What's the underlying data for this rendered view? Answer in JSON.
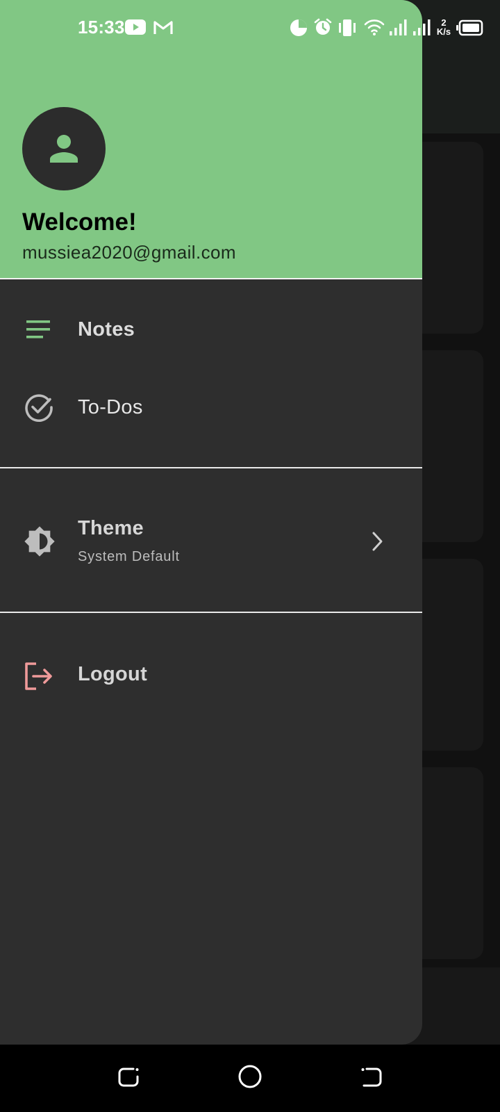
{
  "status_bar": {
    "time": "15:33",
    "net_speed_value": "2",
    "net_speed_unit": "K/s",
    "icons": [
      "youtube-icon",
      "gmail-icon",
      "data-saver-icon",
      "alarm-icon",
      "vibrate-icon",
      "wifi-icon",
      "signal-icon",
      "signal-icon",
      "battery-icon"
    ]
  },
  "drawer": {
    "header": {
      "greeting": "Welcome!",
      "email": "mussiea2020@gmail.com",
      "avatar_icon": "person-icon"
    },
    "items": [
      {
        "label": "Notes",
        "icon": "notes-icon",
        "selected": true
      },
      {
        "label": "To-Dos",
        "icon": "check-circle-icon",
        "selected": false
      }
    ],
    "settings": {
      "theme_label": "Theme",
      "theme_value": "System Default",
      "theme_icon": "brightness-icon",
      "chevron_icon": "chevron-right-icon"
    },
    "logout": {
      "label": "Logout",
      "icon": "logout-icon"
    }
  },
  "nav_bar": {
    "buttons": [
      "recents-icon",
      "home-icon",
      "back-icon"
    ]
  },
  "colors": {
    "accent": "#81c784",
    "drawer_bg": "#2e2e2e",
    "logout_icon": "#ef9a9a",
    "text_primary": "#e8e8e8"
  }
}
